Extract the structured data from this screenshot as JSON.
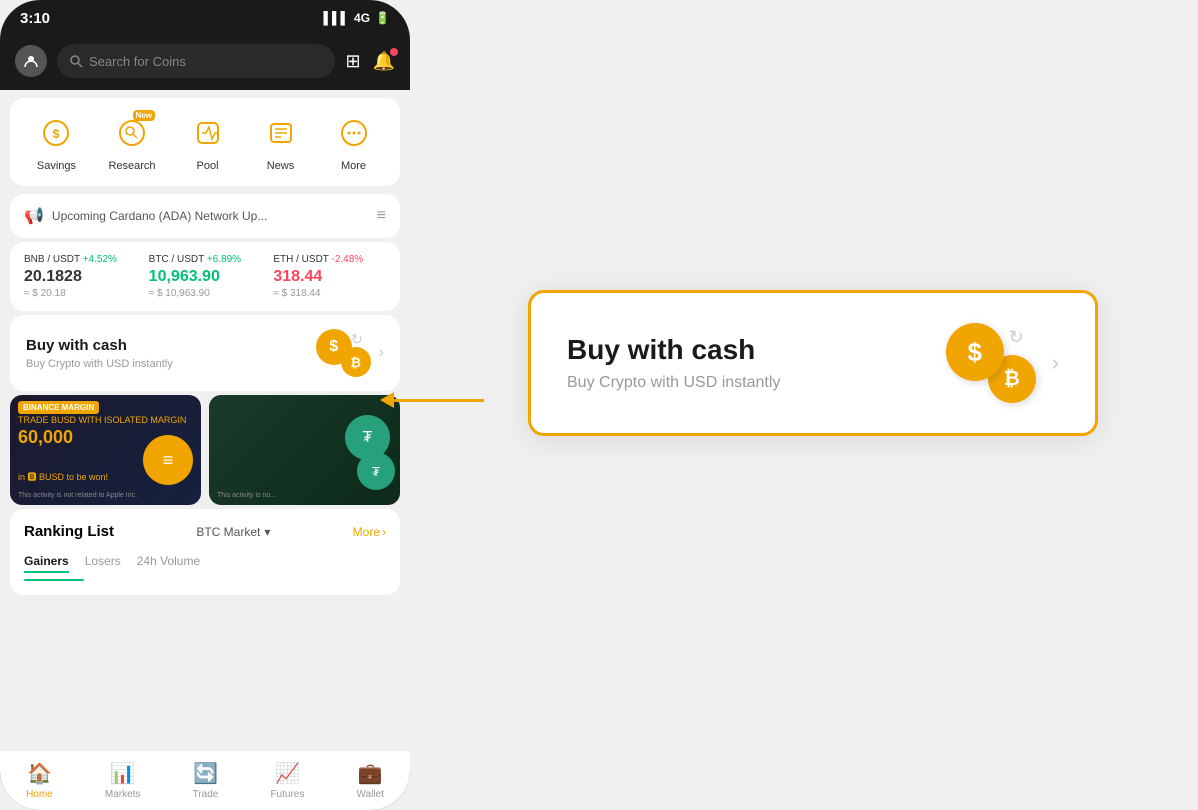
{
  "status": {
    "time": "3:10",
    "signal": "4G",
    "battery": "🔋"
  },
  "topbar": {
    "search_placeholder": "Search for Coins"
  },
  "quickmenu": {
    "items": [
      {
        "label": "Savings",
        "icon": "savings"
      },
      {
        "label": "Research",
        "icon": "research",
        "badge": "New"
      },
      {
        "label": "Pool",
        "icon": "pool"
      },
      {
        "label": "News",
        "icon": "news"
      },
      {
        "label": "More",
        "icon": "more"
      }
    ]
  },
  "announcement": {
    "text": "Upcoming Cardano (ADA) Network Up..."
  },
  "tickers": [
    {
      "pair": "BNB / USDT",
      "change": "+4.52%",
      "positive": true,
      "price": "20.1828",
      "usd": "≈ $ 20.18"
    },
    {
      "pair": "BTC / USDT",
      "change": "+6.89%",
      "positive": true,
      "price": "10,963.90",
      "usd": "≈ $ 10,963.90"
    },
    {
      "pair": "ETH / USDT",
      "change": "-2.48%",
      "positive": false,
      "price": "318.44",
      "usd": "≈ $ 318.44"
    }
  ],
  "buy_cash": {
    "title": "Buy with cash",
    "subtitle": "Buy Crypto with USD instantly"
  },
  "banners": [
    {
      "label": "BINANCE MARGIN",
      "text": "TRADE BUSD WITH ISOLATED MARGIN",
      "amount": "60,000",
      "sub": "in BUSD to be won!",
      "disclaimer": "This activity is not related to Apple Inc."
    },
    {
      "disclaimer": "This activity is no..."
    }
  ],
  "ranking": {
    "title": "Ranking List",
    "market": "BTC Market",
    "more": "More",
    "tabs": [
      "Gainers",
      "Losers",
      "24h Volume"
    ]
  },
  "popup": {
    "title": "Buy with cash",
    "subtitle": "Buy Crypto with USD instantly"
  },
  "bottomnav": {
    "items": [
      {
        "label": "Home",
        "active": true
      },
      {
        "label": "Markets",
        "active": false
      },
      {
        "label": "Trade",
        "active": false
      },
      {
        "label": "Futures",
        "active": false
      },
      {
        "label": "Wallet",
        "active": false
      }
    ]
  }
}
